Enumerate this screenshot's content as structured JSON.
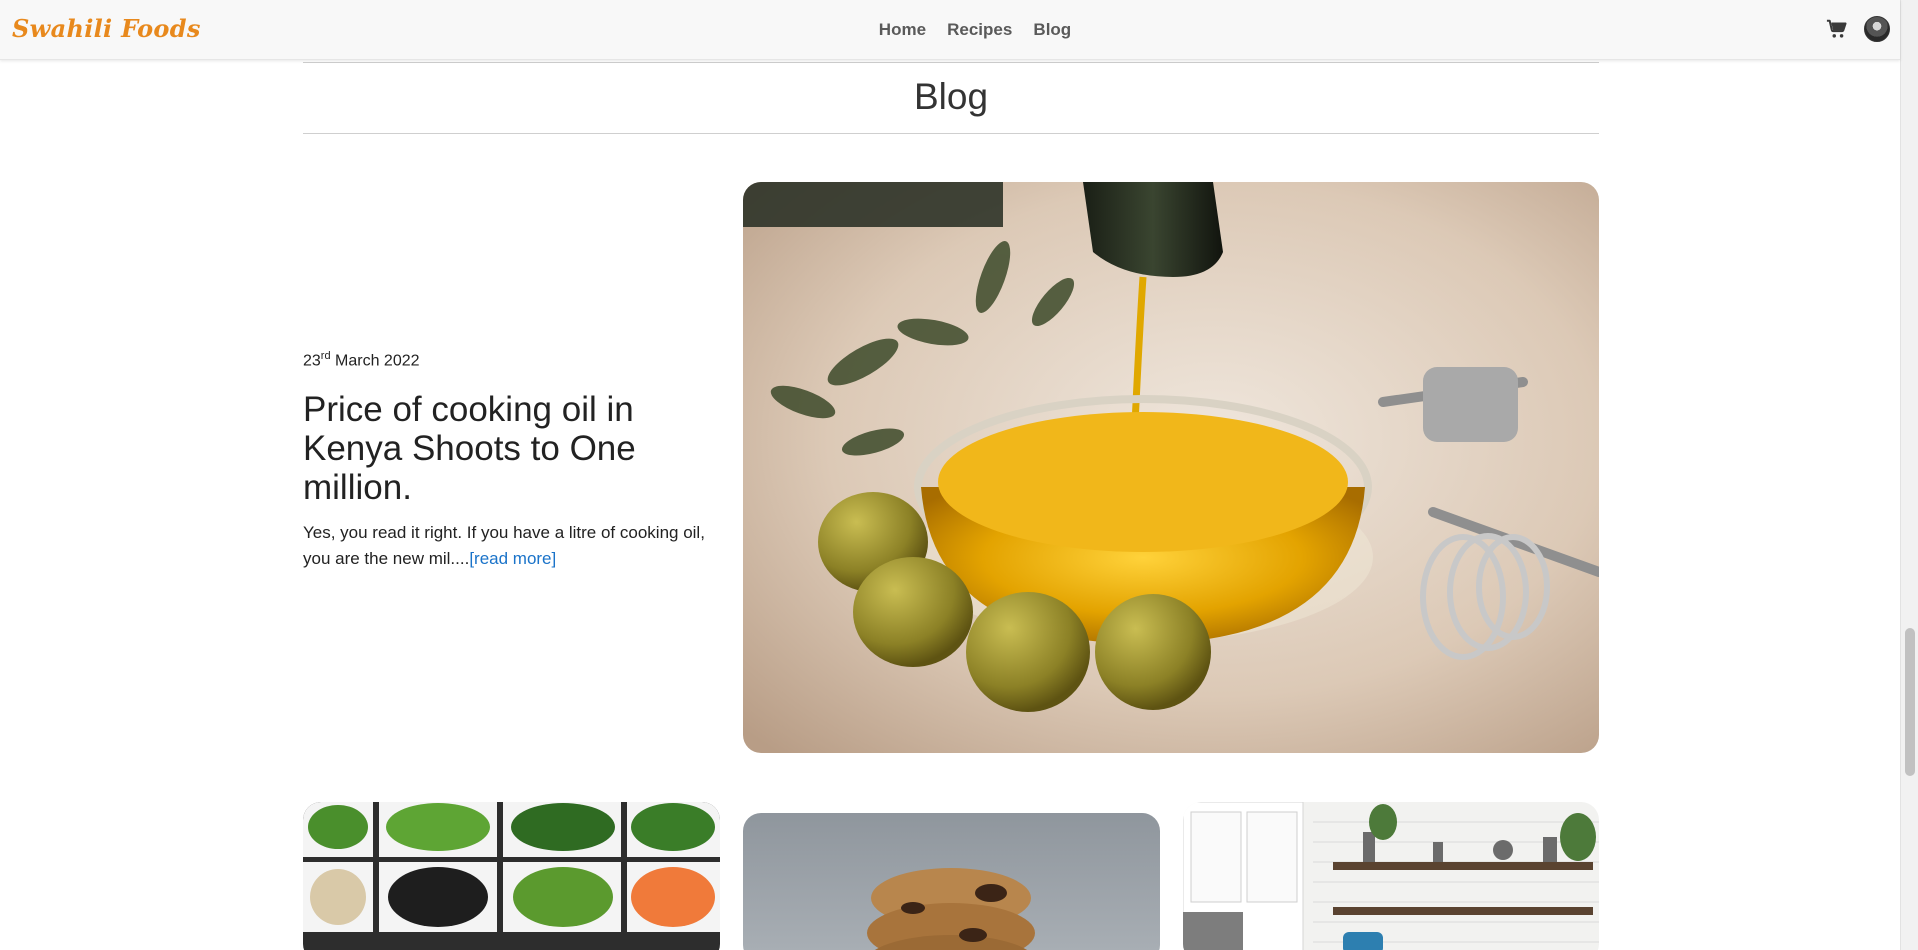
{
  "nav": {
    "brand": "Swahili Foods",
    "links": [
      "Home",
      "Recipes",
      "Blog"
    ],
    "cart_icon": "cart-icon",
    "avatar_icon": "user-avatar"
  },
  "page": {
    "title": "Blog"
  },
  "featured_post": {
    "date_day": "23",
    "date_suffix": "rd",
    "date_rest": " March 2022",
    "title": "Price of cooking oil in Kenya Shoots to One million.",
    "excerpt": "Yes, you read it right. If you have a litre of cooking oil, you are the new mil....",
    "read_more": "[read more]",
    "image": "olive-oil-bowl-photo"
  },
  "cards": [
    {
      "image": "vegetable-trays-photo"
    },
    {
      "image": "cookie-stack-photo"
    },
    {
      "image": "kitchen-shelves-photo"
    }
  ],
  "colors": {
    "brand": "#e8891d",
    "link": "#1a73c9",
    "nav_text": "#5a5a5a"
  }
}
